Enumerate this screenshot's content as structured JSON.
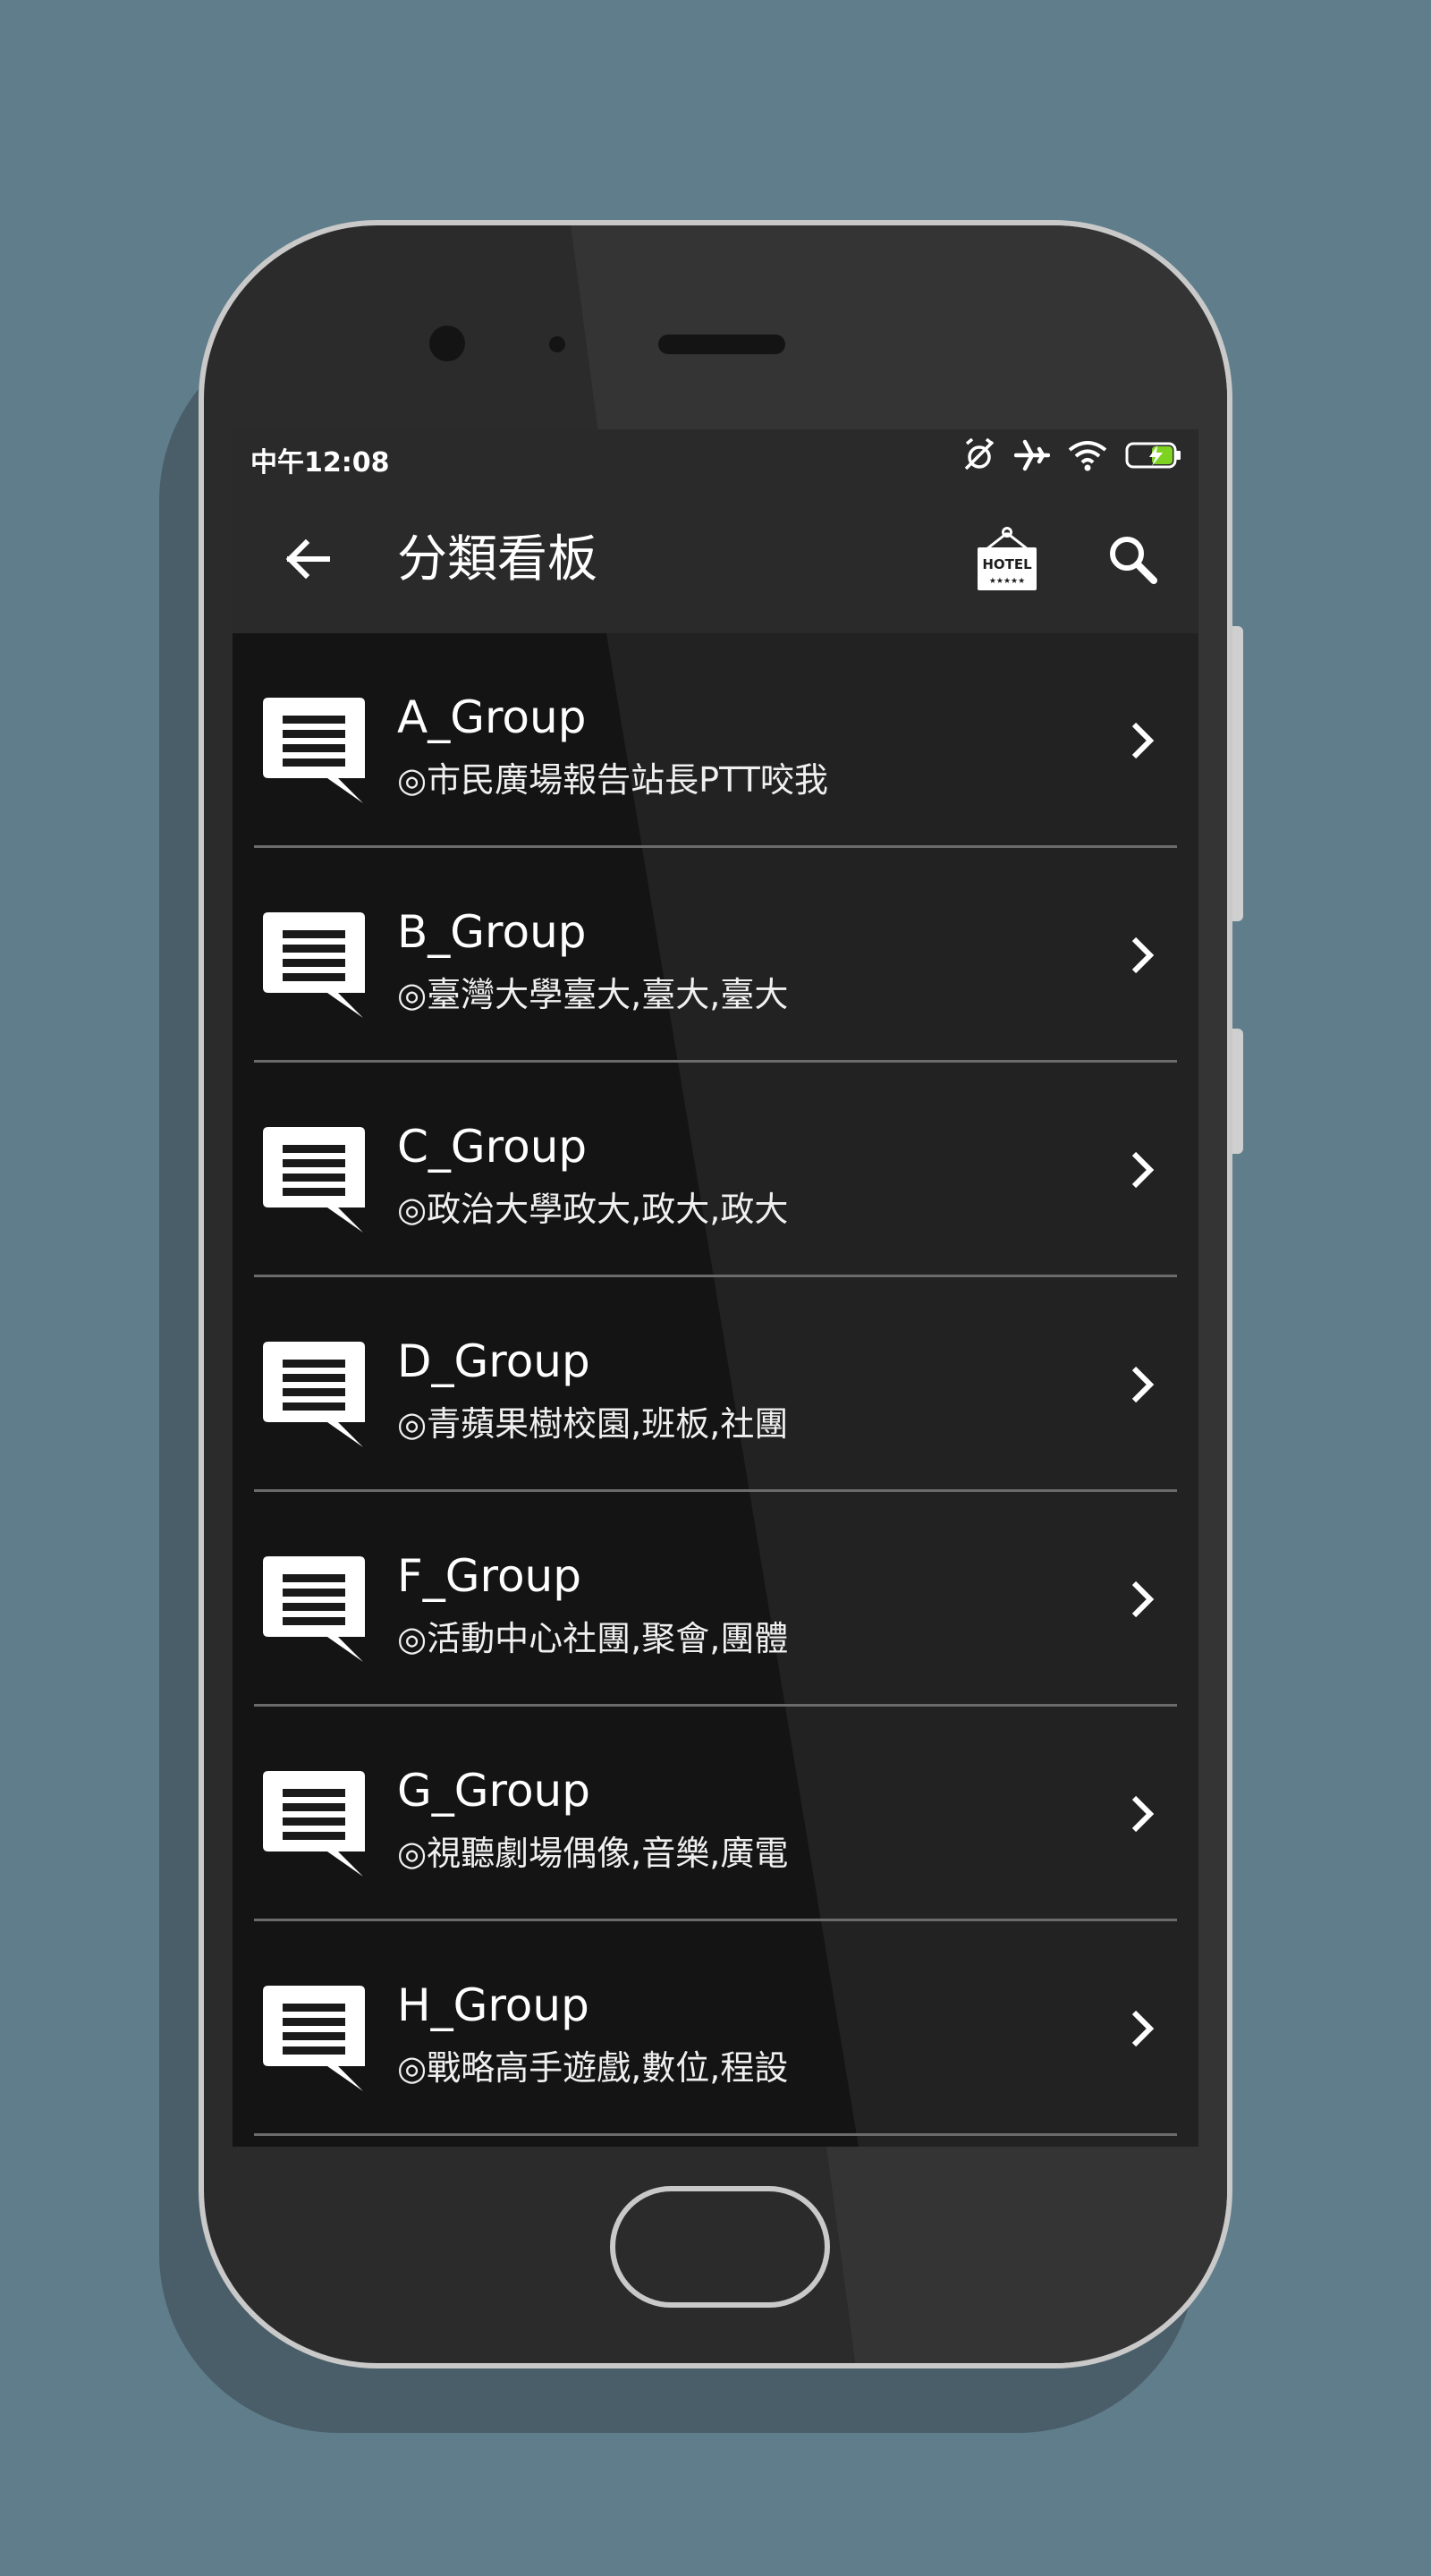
{
  "status_bar": {
    "time": "中午12:08"
  },
  "app_bar": {
    "title": "分類看板",
    "hotel_sign_text": "HOTEL",
    "hotel_stars": "★★★★★"
  },
  "groups": [
    {
      "name": "A_Group",
      "desc": "◎市民廣場報告站長PTT咬我"
    },
    {
      "name": "B_Group",
      "desc": "◎臺灣大學臺大,臺大,臺大"
    },
    {
      "name": "C_Group",
      "desc": "◎政治大學政大,政大,政大"
    },
    {
      "name": "D_Group",
      "desc": "◎青蘋果樹校園,班板,社團"
    },
    {
      "name": "F_Group",
      "desc": "◎活動中心社團,聚會,團體"
    },
    {
      "name": "G_Group",
      "desc": "◎視聽劇場偶像,音樂,廣電"
    },
    {
      "name": "H_Group",
      "desc": "◎戰略高手遊戲,數位,程設"
    }
  ],
  "colors": {
    "background": "#607d8b",
    "screen": "#141414",
    "app_bar": "#2a2a2a",
    "battery_charge": "#7ed321"
  },
  "icons": {
    "back": "arrow-left-icon",
    "hotel": "hotel-sign-icon",
    "search": "search-icon",
    "group": "chat-bubble-icon",
    "chevron": "chevron-right-icon",
    "alarm_off": "alarm-off-icon",
    "airplane": "airplane-icon",
    "wifi": "wifi-icon",
    "battery": "battery-charging-icon"
  }
}
